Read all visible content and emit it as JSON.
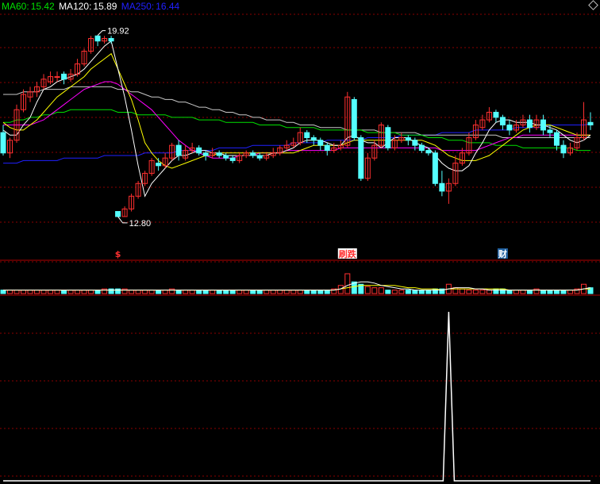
{
  "legend": [
    {
      "name": "MA60",
      "label": "MA60:",
      "value": "15.42",
      "color": "#00e000"
    },
    {
      "name": "MA120",
      "label": "MA120:",
      "value": "15.89",
      "color": "#ffffff"
    },
    {
      "name": "MA250",
      "label": "MA250:",
      "value": "16.44",
      "color": "#2020ff"
    }
  ],
  "colors": {
    "up": "#ff3030",
    "down": "#54ffff",
    "ma5": "#ffffff",
    "ma10": "#ffff00",
    "ma20": "#ff00ff",
    "ma60": "#00e000",
    "ma120": "#c8c8c8",
    "ma250": "#2020ff",
    "grid": "#8b0000",
    "vol_ma5": "#ffffff",
    "vol_ma10": "#ffff00"
  },
  "price_labels": {
    "high": "19.92",
    "low": "12.80"
  },
  "markers": [
    {
      "name": "s-marker",
      "text": "$",
      "index": 17,
      "color": "#ff3030"
    },
    {
      "name": "news-marker-1",
      "text": "刷跌",
      "index": 51,
      "color": "#ff3030",
      "bg": "#ffffff"
    },
    {
      "name": "news-marker-2",
      "text": "财",
      "index": 74,
      "color": "#ffffff",
      "bg": "#2060a0"
    }
  ],
  "chart_data": {
    "type": "candlestick",
    "ylim": [
      11.8,
      21.0
    ],
    "candles": [
      [
        16.1,
        15.3,
        16.4,
        15.2
      ],
      [
        15.3,
        15.8,
        15.9,
        15.1
      ],
      [
        15.8,
        17.0,
        17.2,
        15.7
      ],
      [
        17.0,
        17.6,
        17.8,
        16.9
      ],
      [
        17.5,
        17.7,
        17.9,
        17.3
      ],
      [
        17.7,
        17.9,
        18.1,
        17.5
      ],
      [
        17.9,
        18.2,
        18.4,
        17.8
      ],
      [
        18.1,
        18.3,
        18.5,
        18.0
      ],
      [
        18.3,
        18.3,
        18.5,
        18.1
      ],
      [
        18.4,
        18.2,
        18.5,
        18.0
      ],
      [
        18.2,
        18.4,
        18.6,
        18.1
      ],
      [
        18.4,
        18.8,
        19.0,
        18.3
      ],
      [
        18.8,
        19.3,
        19.4,
        18.7
      ],
      [
        19.3,
        19.8,
        19.9,
        19.2
      ],
      [
        19.9,
        19.7,
        19.92,
        19.5
      ],
      [
        19.7,
        19.8,
        19.9,
        19.6
      ],
      [
        19.8,
        19.7,
        19.9,
        19.6
      ],
      [
        13.0,
        12.8,
        13.0,
        12.8
      ],
      [
        12.8,
        13.1,
        13.2,
        12.8
      ],
      [
        13.1,
        13.6,
        13.7,
        13.0
      ],
      [
        13.6,
        14.1,
        14.2,
        13.5
      ],
      [
        14.1,
        14.5,
        14.6,
        14.0
      ],
      [
        14.5,
        15.0,
        15.1,
        14.4
      ],
      [
        14.9,
        14.8,
        15.1,
        14.6
      ],
      [
        14.8,
        15.1,
        15.3,
        14.7
      ],
      [
        15.1,
        15.6,
        15.7,
        15.0
      ],
      [
        15.6,
        15.2,
        15.8,
        15.0
      ],
      [
        15.1,
        15.4,
        15.6,
        15.0
      ],
      [
        15.4,
        15.5,
        15.7,
        15.3
      ],
      [
        15.5,
        15.3,
        15.6,
        15.2
      ],
      [
        15.3,
        15.2,
        15.4,
        15.0
      ],
      [
        15.2,
        15.3,
        15.5,
        15.1
      ],
      [
        15.3,
        15.2,
        15.4,
        15.1
      ],
      [
        15.2,
        15.1,
        15.3,
        15.0
      ],
      [
        15.1,
        15.0,
        15.2,
        14.9
      ],
      [
        15.0,
        15.2,
        15.3,
        14.9
      ],
      [
        15.2,
        15.3,
        15.4,
        15.1
      ],
      [
        15.3,
        15.2,
        15.4,
        15.1
      ],
      [
        15.2,
        15.1,
        15.3,
        15.0
      ],
      [
        15.1,
        15.2,
        15.3,
        15.0
      ],
      [
        15.2,
        15.3,
        15.5,
        15.1
      ],
      [
        15.3,
        15.5,
        15.6,
        15.2
      ],
      [
        15.5,
        15.6,
        15.8,
        15.4
      ],
      [
        15.6,
        15.7,
        15.9,
        15.5
      ],
      [
        15.7,
        16.1,
        16.3,
        15.6
      ],
      [
        16.1,
        15.9,
        16.2,
        15.7
      ],
      [
        15.9,
        15.8,
        16.0,
        15.6
      ],
      [
        15.8,
        15.6,
        15.9,
        15.4
      ],
      [
        15.6,
        15.4,
        15.7,
        15.2
      ],
      [
        15.4,
        15.5,
        15.7,
        15.3
      ],
      [
        15.5,
        15.6,
        15.8,
        15.4
      ],
      [
        15.6,
        17.5,
        17.7,
        15.5
      ],
      [
        17.4,
        15.9,
        17.5,
        15.8
      ],
      [
        15.9,
        14.3,
        16.0,
        14.2
      ],
      [
        14.3,
        15.1,
        15.3,
        14.2
      ],
      [
        15.1,
        15.6,
        15.8,
        15.0
      ],
      [
        15.6,
        16.4,
        16.5,
        15.5
      ],
      [
        16.3,
        15.5,
        16.4,
        15.4
      ],
      [
        15.5,
        15.8,
        16.0,
        15.4
      ],
      [
        15.8,
        15.9,
        16.1,
        15.7
      ],
      [
        15.9,
        15.8,
        16.0,
        15.6
      ],
      [
        15.8,
        15.6,
        15.9,
        15.4
      ],
      [
        15.6,
        15.4,
        15.7,
        15.3
      ],
      [
        15.4,
        15.3,
        15.5,
        15.2
      ],
      [
        15.3,
        14.1,
        15.4,
        14.0
      ],
      [
        14.1,
        13.8,
        14.6,
        13.6
      ],
      [
        13.8,
        14.1,
        14.3,
        13.3
      ],
      [
        14.1,
        14.9,
        15.2,
        14.0
      ],
      [
        14.9,
        15.3,
        15.5,
        14.8
      ],
      [
        15.3,
        15.9,
        16.1,
        15.2
      ],
      [
        15.9,
        16.4,
        16.6,
        15.8
      ],
      [
        16.3,
        16.6,
        16.8,
        16.2
      ],
      [
        16.6,
        16.9,
        17.1,
        16.5
      ],
      [
        16.9,
        16.7,
        17.0,
        16.5
      ],
      [
        16.7,
        16.4,
        16.8,
        16.2
      ],
      [
        16.4,
        16.2,
        16.6,
        16.0
      ],
      [
        16.2,
        16.4,
        16.6,
        16.1
      ],
      [
        16.4,
        16.6,
        16.8,
        16.3
      ],
      [
        16.6,
        16.3,
        16.8,
        16.1
      ],
      [
        16.3,
        16.6,
        16.8,
        16.2
      ],
      [
        16.6,
        16.2,
        16.8,
        16.0
      ],
      [
        16.2,
        16.1,
        16.4,
        15.9
      ],
      [
        16.1,
        15.6,
        16.2,
        15.4
      ],
      [
        15.6,
        15.3,
        15.8,
        15.1
      ],
      [
        15.3,
        15.5,
        15.7,
        15.2
      ],
      [
        15.5,
        15.9,
        16.1,
        15.4
      ],
      [
        15.9,
        16.6,
        17.3,
        15.8
      ],
      [
        16.5,
        16.4,
        16.9,
        16.2
      ]
    ],
    "ma5": [
      16.2,
      16.0,
      16.0,
      16.4,
      16.7,
      17.3,
      17.8,
      17.9,
      18.1,
      18.2,
      18.3,
      18.4,
      18.6,
      18.9,
      19.2,
      19.5,
      19.7,
      18.6,
      17.5,
      16.2,
      14.8,
      13.6,
      14.1,
      14.4,
      14.7,
      15.0,
      15.2,
      15.2,
      15.3,
      15.4,
      15.4,
      15.3,
      15.3,
      15.2,
      15.2,
      15.2,
      15.2,
      15.2,
      15.2,
      15.2,
      15.3,
      15.3,
      15.4,
      15.5,
      15.7,
      15.8,
      15.8,
      15.8,
      15.7,
      15.6,
      15.6,
      15.9,
      16.0,
      15.8,
      15.7,
      15.7,
      15.5,
      15.7,
      15.9,
      15.9,
      15.9,
      15.7,
      15.6,
      15.5,
      15.2,
      14.9,
      14.7,
      14.6,
      14.6,
      14.8,
      15.3,
      15.7,
      16.2,
      16.5,
      16.6,
      16.6,
      16.5,
      16.5,
      16.5,
      16.4,
      16.4,
      16.3,
      16.2,
      16.0,
      15.8,
      15.7,
      15.8,
      16.0
    ],
    "ma10": [
      16.5,
      16.3,
      16.2,
      16.2,
      16.4,
      16.6,
      16.9,
      17.2,
      17.5,
      17.7,
      17.9,
      18.1,
      18.3,
      18.6,
      18.8,
      19.0,
      19.2,
      18.6,
      18.0,
      17.4,
      16.6,
      15.7,
      15.3,
      15.0,
      14.8,
      14.7,
      14.8,
      14.9,
      15.0,
      15.1,
      15.2,
      15.2,
      15.3,
      15.3,
      15.3,
      15.3,
      15.3,
      15.3,
      15.3,
      15.3,
      15.3,
      15.3,
      15.3,
      15.3,
      15.4,
      15.5,
      15.6,
      15.6,
      15.6,
      15.6,
      15.6,
      15.7,
      15.8,
      15.8,
      15.8,
      15.8,
      15.8,
      15.8,
      15.8,
      15.8,
      15.8,
      15.8,
      15.8,
      15.7,
      15.6,
      15.4,
      15.2,
      15.1,
      15.0,
      15.0,
      15.0,
      15.1,
      15.2,
      15.4,
      15.6,
      15.8,
      16.0,
      16.2,
      16.3,
      16.4,
      16.4,
      16.4,
      16.3,
      16.2,
      16.1,
      16.0,
      16.0,
      16.0
    ],
    "ma20": [
      16.4,
      16.4,
      16.4,
      16.4,
      16.4,
      16.5,
      16.6,
      16.8,
      17.0,
      17.2,
      17.4,
      17.6,
      17.8,
      17.9,
      18.0,
      18.1,
      18.1,
      18.0,
      17.8,
      17.6,
      17.4,
      17.2,
      17.0,
      16.7,
      16.4,
      16.1,
      15.8,
      15.6,
      15.4,
      15.3,
      15.2,
      15.1,
      15.1,
      15.1,
      15.1,
      15.2,
      15.2,
      15.2,
      15.3,
      15.3,
      15.3,
      15.3,
      15.4,
      15.4,
      15.4,
      15.4,
      15.4,
      15.4,
      15.4,
      15.4,
      15.5,
      15.5,
      15.5,
      15.5,
      15.5,
      15.5,
      15.5,
      15.5,
      15.5,
      15.5,
      15.5,
      15.5,
      15.5,
      15.5,
      15.5,
      15.4,
      15.4,
      15.4,
      15.4,
      15.4,
      15.4,
      15.5,
      15.6,
      15.7,
      15.8,
      15.9,
      15.9,
      16.0,
      16.0,
      16.0,
      16.0,
      16.0,
      16.0,
      16.0,
      16.0,
      16.0,
      16.0,
      16.0
    ],
    "ma60": [
      16.5,
      16.5,
      16.6,
      16.6,
      16.7,
      16.7,
      16.8,
      16.8,
      16.9,
      16.9,
      17.0,
      17.0,
      17.0,
      17.0,
      17.0,
      17.0,
      17.0,
      16.9,
      16.9,
      16.9,
      16.8,
      16.8,
      16.8,
      16.8,
      16.8,
      16.7,
      16.7,
      16.7,
      16.7,
      16.6,
      16.6,
      16.6,
      16.6,
      16.5,
      16.5,
      16.5,
      16.5,
      16.5,
      16.4,
      16.4,
      16.4,
      16.4,
      16.3,
      16.3,
      16.3,
      16.3,
      16.3,
      16.2,
      16.2,
      16.2,
      16.2,
      16.2,
      16.2,
      16.2,
      16.1,
      16.1,
      16.1,
      16.1,
      16.1,
      16.0,
      16.0,
      16.0,
      16.0,
      15.9,
      15.9,
      15.9,
      15.8,
      15.8,
      15.8,
      15.7,
      15.7,
      15.7,
      15.7,
      15.6,
      15.6,
      15.6,
      15.6,
      15.5,
      15.5,
      15.5,
      15.5,
      15.5,
      15.5,
      15.5,
      15.5,
      15.4,
      15.4,
      15.4
    ],
    "ma120": [
      17.6,
      17.6,
      17.6,
      17.7,
      17.7,
      17.7,
      17.8,
      17.8,
      17.8,
      17.8,
      17.9,
      17.9,
      17.9,
      17.9,
      17.9,
      17.9,
      17.9,
      17.8,
      17.8,
      17.7,
      17.7,
      17.6,
      17.5,
      17.5,
      17.4,
      17.4,
      17.3,
      17.3,
      17.2,
      17.1,
      17.1,
      17.0,
      17.0,
      16.9,
      16.9,
      16.8,
      16.8,
      16.7,
      16.7,
      16.6,
      16.6,
      16.6,
      16.5,
      16.5,
      16.4,
      16.4,
      16.4,
      16.3,
      16.3,
      16.3,
      16.3,
      16.2,
      16.2,
      16.2,
      16.2,
      16.2,
      16.1,
      16.1,
      16.1,
      16.1,
      16.1,
      16.1,
      16.0,
      16.0,
      16.0,
      16.0,
      16.0,
      16.0,
      16.0,
      16.0,
      16.0,
      16.0,
      16.0,
      16.0,
      15.9,
      15.9,
      15.9,
      15.9,
      15.9,
      15.9,
      15.9,
      15.9,
      15.9,
      15.9,
      15.9,
      15.9,
      15.9,
      15.9
    ],
    "ma250": [
      14.9,
      14.9,
      14.9,
      15.0,
      15.0,
      15.0,
      15.0,
      15.0,
      15.0,
      15.1,
      15.1,
      15.1,
      15.1,
      15.1,
      15.1,
      15.2,
      15.2,
      15.2,
      15.2,
      15.2,
      15.2,
      15.3,
      15.3,
      15.3,
      15.3,
      15.3,
      15.4,
      15.4,
      15.4,
      15.4,
      15.4,
      15.4,
      15.5,
      15.5,
      15.5,
      15.5,
      15.5,
      15.6,
      15.6,
      15.6,
      15.6,
      15.6,
      15.6,
      15.7,
      15.7,
      15.7,
      15.7,
      15.7,
      15.8,
      15.8,
      15.8,
      15.8,
      15.8,
      15.8,
      15.9,
      15.9,
      15.9,
      15.9,
      15.9,
      16.0,
      16.0,
      16.0,
      16.0,
      16.0,
      16.0,
      16.1,
      16.1,
      16.1,
      16.1,
      16.1,
      16.2,
      16.2,
      16.2,
      16.2,
      16.2,
      16.2,
      16.3,
      16.3,
      16.3,
      16.3,
      16.3,
      16.4,
      16.4,
      16.4,
      16.4,
      16.4,
      16.4,
      16.44
    ],
    "volume": [
      3,
      3,
      3,
      3,
      3,
      3,
      3,
      3,
      3,
      3,
      3,
      3,
      3,
      3,
      3,
      4,
      4,
      4,
      4,
      3,
      3,
      3,
      3,
      3,
      3,
      4,
      3,
      3,
      3,
      3,
      3,
      3,
      3,
      3,
      3,
      3,
      3,
      3,
      3,
      3,
      3,
      3,
      3,
      3,
      3,
      3,
      3,
      3,
      3,
      4,
      7,
      17,
      10,
      8,
      6,
      5,
      5,
      3,
      3,
      3,
      3,
      3,
      3,
      3,
      4,
      4,
      8,
      5,
      4,
      3,
      3,
      3,
      3,
      4,
      4,
      3,
      3,
      3,
      3,
      4,
      3,
      3,
      3,
      3,
      3,
      4,
      8,
      5
    ],
    "vol_ma5": [
      3,
      3,
      3,
      3,
      3,
      3,
      3,
      3,
      3,
      3,
      3,
      3,
      3,
      3,
      3,
      3,
      3,
      3,
      3,
      3,
      3,
      3,
      3,
      3,
      3,
      3,
      3,
      3,
      3,
      3,
      3,
      3,
      3,
      3,
      3,
      3,
      3,
      3,
      3,
      3,
      3,
      3,
      3,
      3,
      3,
      3,
      3,
      3,
      3,
      3,
      4,
      7,
      9,
      10,
      10,
      9,
      7,
      6,
      5,
      4,
      4,
      3,
      3,
      3,
      3,
      3,
      4,
      5,
      5,
      5,
      4,
      4,
      3,
      3,
      3,
      3,
      3,
      3,
      3,
      3,
      3,
      3,
      3,
      3,
      3,
      3,
      4,
      5
    ],
    "vol_ma10": [
      3,
      3,
      3,
      3,
      3,
      3,
      3,
      3,
      3,
      3,
      3,
      3,
      3,
      3,
      3,
      3,
      3,
      3,
      3,
      3,
      3,
      3,
      3,
      3,
      3,
      3,
      3,
      3,
      3,
      3,
      3,
      3,
      3,
      3,
      3,
      3,
      3,
      3,
      3,
      3,
      3,
      3,
      3,
      3,
      3,
      3,
      3,
      3,
      3,
      3,
      4,
      5,
      6,
      7,
      7,
      7,
      7,
      7,
      7,
      6,
      5,
      5,
      4,
      4,
      4,
      3,
      4,
      4,
      4,
      4,
      4,
      4,
      4,
      4,
      4,
      3,
      3,
      3,
      3,
      3,
      3,
      3,
      3,
      3,
      3,
      3,
      4,
      4
    ],
    "indicator": [
      0,
      0,
      0,
      0,
      0,
      0,
      0,
      0,
      0,
      0,
      0,
      0,
      0,
      0,
      0,
      0,
      0,
      0,
      0,
      0,
      0,
      0,
      0,
      0,
      0,
      0,
      0,
      0,
      0,
      0,
      0,
      0,
      0,
      0,
      0,
      0,
      0,
      0,
      0,
      0,
      0,
      0,
      0,
      0,
      0,
      0,
      0,
      0,
      0,
      0,
      0,
      0,
      0,
      0,
      0,
      0,
      0,
      0,
      0,
      0,
      0,
      0,
      0,
      0,
      0,
      0,
      1,
      0,
      0,
      0,
      0,
      0,
      0,
      0,
      0,
      0,
      0,
      0,
      0,
      0,
      0,
      0,
      0,
      0,
      0,
      0,
      0,
      0
    ]
  }
}
